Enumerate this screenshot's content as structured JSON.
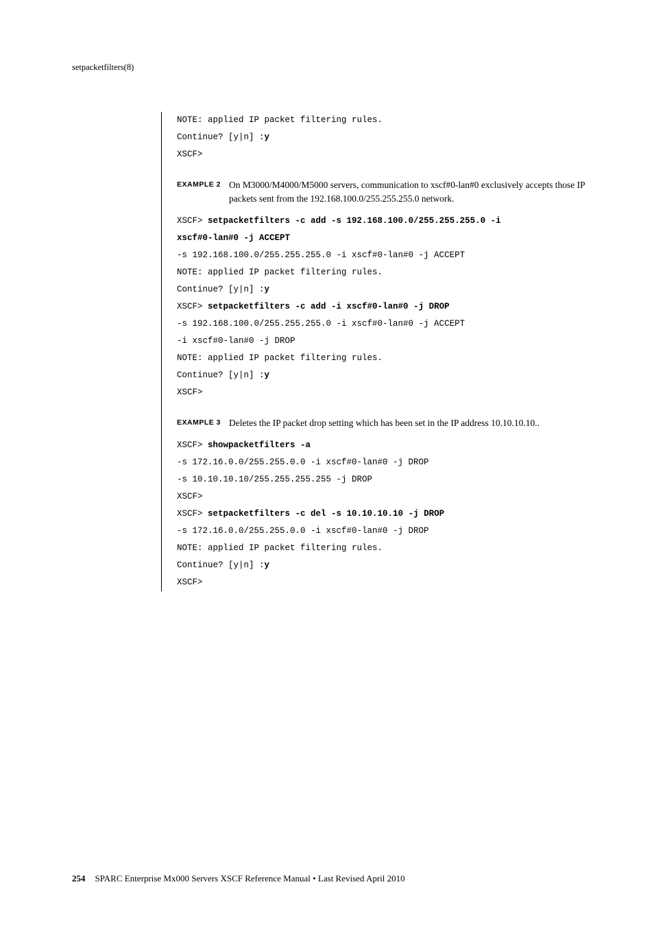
{
  "header": {
    "title": "setpacketfilters(8)"
  },
  "block1": {
    "line1": "NOTE: applied IP packet filtering rules.",
    "line2a": "Continue? [y|n] :",
    "line2b": "y",
    "line3": "XSCF>"
  },
  "example2": {
    "label": "EXAMPLE 2",
    "text": "On M3000/M4000/M5000 servers, communication to xscf#0-lan#0 exclusively accepts those IP packets sent from the 192.168.100.0/255.255.255.0 network."
  },
  "block2": {
    "l1a": "XSCF> ",
    "l1b": "setpacketfilters -c add -s 192.168.100.0/255.255.255.0 -i",
    "l1c": "xscf#0-lan#0 -j ACCEPT",
    "l2": "-s 192.168.100.0/255.255.255.0 -i xscf#0-lan#0 -j ACCEPT",
    "l3": "NOTE: applied IP packet filtering rules.",
    "l4a": "Continue? [y|n] :",
    "l4b": "y",
    "l5a": "XSCF> ",
    "l5b": "setpacketfilters -c add -i xscf#0-lan#0 -j DROP",
    "l6": "-s 192.168.100.0/255.255.255.0 -i xscf#0-lan#0 -j ACCEPT",
    "l7": "-i xscf#0-lan#0 -j DROP",
    "l8": "NOTE: applied IP packet filtering rules.",
    "l9a": "Continue? [y|n] :",
    "l9b": "y",
    "l10": "XSCF>"
  },
  "example3": {
    "label": "EXAMPLE 3",
    "text": "Deletes the IP packet drop setting which has been set in the IP address 10.10.10.10.."
  },
  "block3": {
    "l1a": "XSCF> ",
    "l1b": "showpacketfilters -a",
    "l2": "-s 172.16.0.0/255.255.0.0 -i xscf#0-lan#0 -j DROP",
    "l3": "-s 10.10.10.10/255.255.255.255 -j DROP",
    "l4": "XSCF>",
    "l5a": "XSCF> ",
    "l5b": "setpacketfilters -c del -s 10.10.10.10 -j DROP",
    "l6": "-s 172.16.0.0/255.255.0.0 -i xscf#0-lan#0 -j DROP",
    "l7": "NOTE: applied IP packet filtering rules.",
    "l8a": "Continue? [y|n] :",
    "l8b": "y",
    "l9": "XSCF>"
  },
  "footer": {
    "page": "254",
    "text": "SPARC Enterprise Mx000 Servers XSCF Reference Manual • Last Revised April 2010"
  }
}
